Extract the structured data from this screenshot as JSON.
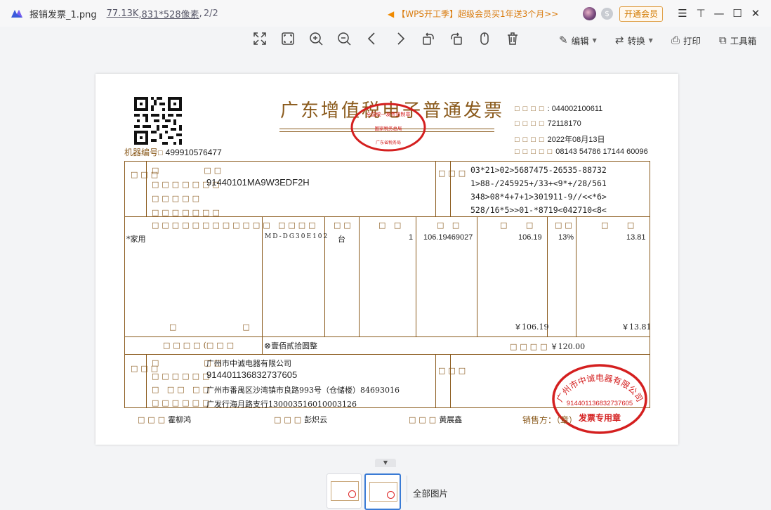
{
  "titlebar": {
    "file_name": "报销发票_1.png",
    "file_size": "77.13K",
    "dimensions": ",831*528像素",
    "separator": ",",
    "page": "2/2",
    "promo": "【WPS开工季】超级会员买1年送3个月>>",
    "open_vip": "开通会员"
  },
  "toolbar": {
    "edit_label": "编辑",
    "convert_label": "转换",
    "print_label": "打印",
    "toolbox_label": "工具箱"
  },
  "invoice": {
    "title": "广东增值税电子普通发票",
    "machine_label": "机器编号",
    "machine_no": "499910576477",
    "invoice_code": ": 044002100611",
    "invoice_no": "72118170",
    "issue_date": "2022年08月13日",
    "check_code": "08143 54786 17144 60096",
    "buyer_tax_id": "91440101MA9W3EDF2H",
    "cipher": [
      "03*21>02>5687475-26535-88732",
      "1>88-/245925+/33+<9*+/28/561",
      "348>08*4+7+1>301911-9//<<*6>",
      "528/16*5>>01-*8719<042710<8<"
    ],
    "item": {
      "name": "*家用",
      "model": "MD-DG30E102",
      "unit": "台",
      "qty": "1",
      "price": "106.19469027",
      "amount": "106.19",
      "tax_rate": "13%",
      "tax": "13.81"
    },
    "subtotal_amount": "￥106.19",
    "subtotal_tax": "￥13.81",
    "total_paren": "(",
    "total_words": "壹佰贰拾圆整",
    "total_value": "￥120.00",
    "seller": {
      "name": "广州市中诚电器有限公司",
      "tax_id": "914401136832737605",
      "address": "广州市番禺区沙湾镇市良路993号（仓储楼）84693016",
      "bank": "广发行海月路支行130003516010003126"
    },
    "payee": "霍柳鸿",
    "reviewer": "彭炽云",
    "drawer": "黄展鑫",
    "seller_footer": "销售方：（章）",
    "stamp_top": "全国统一发票监制章",
    "stamp_top_mid": "国家税务总局",
    "stamp_top_bottom": "广东省税务局",
    "stamp_seller_name": "广州市中诚电器有限公司",
    "stamp_seller_id": "914401136832737605",
    "stamp_seller_bottom": "发票专用章"
  },
  "thumbnails": {
    "all_label": "全部图片"
  },
  "colors": {
    "invoice_brown": "#8a5a1c",
    "stamp_red": "#d41f1f",
    "accent_blue": "#3a7bd5",
    "promo_orange": "#d97a0b"
  }
}
